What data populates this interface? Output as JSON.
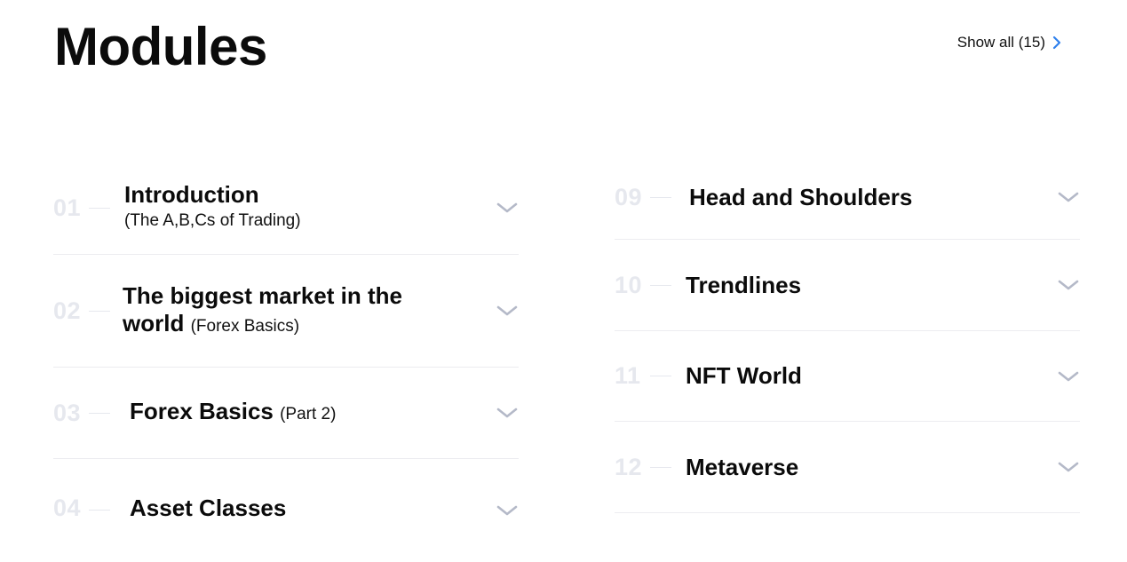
{
  "header": {
    "title": "Modules",
    "show_all_label": "Show all (15)"
  },
  "colors": {
    "accent": "#2f80ed",
    "number": "#e6e8ee",
    "chevron": "#b4b9c8",
    "divider": "#ececf0"
  },
  "modules_left": [
    {
      "number": "01",
      "title": "Introduction",
      "subtitle": "(The A,B,Cs of Trading)"
    },
    {
      "number": "02",
      "title": "The biggest market in the world",
      "title_line1": "The biggest market in the",
      "title_line2": "world",
      "subtitle": "(Forex Basics)"
    },
    {
      "number": "03",
      "title": "Forex Basics",
      "subtitle": "(Part 2)"
    },
    {
      "number": "04",
      "title": "Asset Classes",
      "subtitle": ""
    }
  ],
  "modules_right": [
    {
      "number": "09",
      "title": "Head and Shoulders",
      "subtitle": ""
    },
    {
      "number": "10",
      "title": "Trendlines",
      "subtitle": ""
    },
    {
      "number": "11",
      "title": "NFT World",
      "subtitle": ""
    },
    {
      "number": "12",
      "title": "Metaverse",
      "subtitle": ""
    }
  ]
}
